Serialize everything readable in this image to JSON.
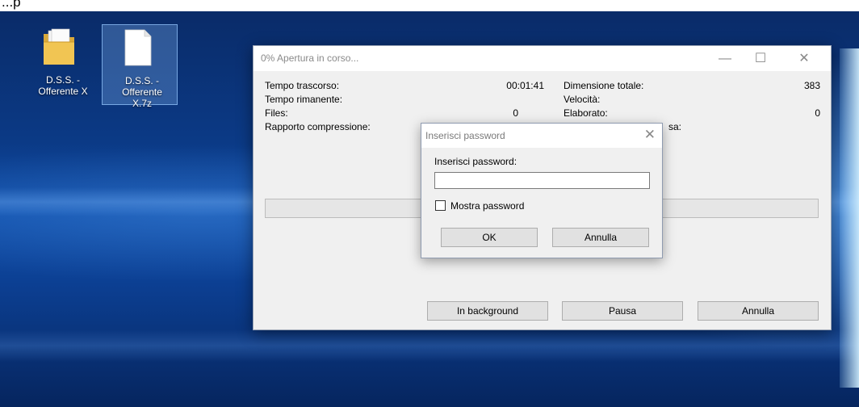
{
  "note": {
    "text": "...p"
  },
  "desktop": {
    "icons": [
      {
        "label": "D.S.S. - Offerente X",
        "type": "folder"
      },
      {
        "label": "D.S.S. - Offerente X.7z",
        "type": "file"
      }
    ]
  },
  "progress_window": {
    "title": "0% Apertura in corso...",
    "left_rows": [
      {
        "label": "Tempo trascorso:",
        "value": "00:01:41"
      },
      {
        "label": "Tempo rimanente:",
        "value": ""
      },
      {
        "label": "Files:",
        "value": "0"
      },
      {
        "label": "Rapporto compressione:",
        "value": ""
      }
    ],
    "right_rows": [
      {
        "label": "Dimensione totale:",
        "value": "383"
      },
      {
        "label": "Velocità:",
        "value": ""
      },
      {
        "label": "Elaborato:",
        "value": "0"
      },
      {
        "label": "sa:",
        "value": ""
      }
    ],
    "progress_percent": 0,
    "buttons": {
      "background": "In background",
      "pause": "Pausa",
      "cancel": "Annulla"
    }
  },
  "password_dialog": {
    "title": "Inserisci password",
    "prompt": "Inserisci password:",
    "password_value": "",
    "show_password_label": "Mostra password",
    "show_password_checked": false,
    "ok_label": "OK",
    "cancel_label": "Annulla"
  },
  "colors": {
    "desktop_blue": "#0b3a86",
    "window_bg": "#f0f0f0",
    "button_bg": "#e1e1e1"
  }
}
